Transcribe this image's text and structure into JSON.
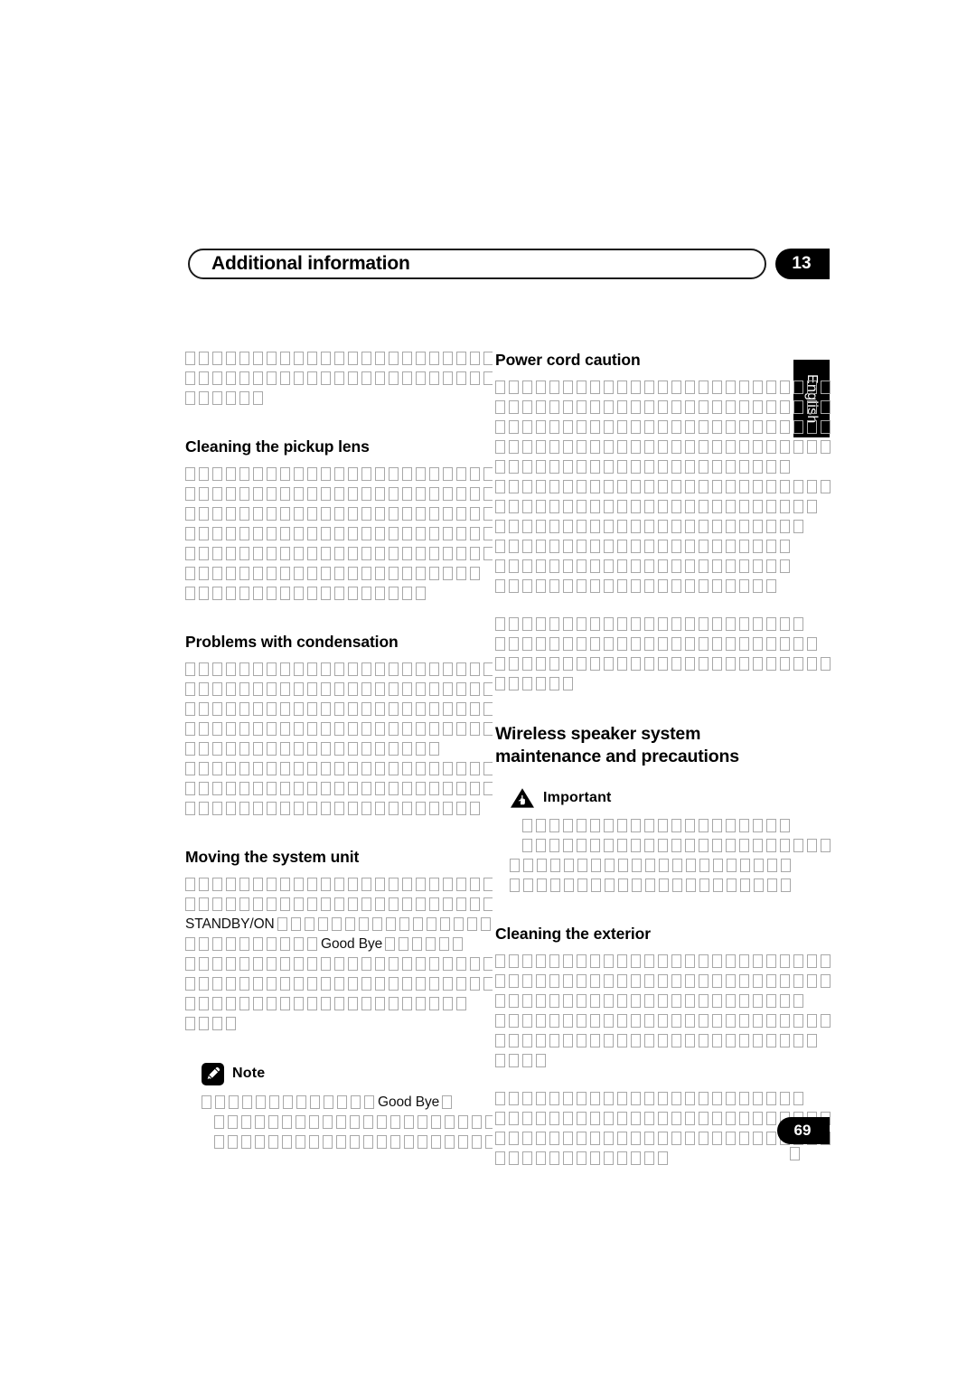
{
  "document": {
    "chapter_number": "13",
    "chapter_title": "Additional information",
    "page_number": "69",
    "language_tab": "English",
    "footer_mark": "□"
  },
  "icons": {
    "note": "pencil-icon",
    "important": "warning-triangle-hand-icon"
  },
  "left_column": {
    "intro_paragraph": {
      "lines": [
        {
          "boxes": 24
        },
        {
          "boxes": 24
        },
        {
          "boxes": 6
        }
      ]
    },
    "sections": [
      {
        "heading": "Cleaning the pickup lens",
        "paragraphs": [
          {
            "lines": [
              {
                "boxes": 24
              },
              {
                "boxes": 24
              },
              {
                "boxes": 24
              },
              {
                "boxes": 23
              },
              {
                "boxes": 23
              },
              {
                "boxes": 22
              },
              {
                "boxes": 18
              }
            ]
          }
        ]
      },
      {
        "heading": "Problems with condensation",
        "paragraphs": [
          {
            "lines": [
              {
                "boxes": 24
              },
              {
                "boxes": 24
              },
              {
                "boxes": 23
              },
              {
                "boxes": 23
              },
              {
                "boxes": 19
              },
              {
                "boxes": 23
              },
              {
                "boxes": 23
              },
              {
                "boxes": 22
              }
            ]
          }
        ]
      },
      {
        "heading": "Moving the system unit",
        "paragraphs": [
          {
            "lines": [
              {
                "boxes": 24
              },
              {
                "boxes": 24
              },
              {
                "runs": [
                  {
                    "type": "latin",
                    "text": "STANDBY/ON"
                  },
                  {
                    "type": "boxes",
                    "count": 17
                  }
                ]
              },
              {
                "runs": [
                  {
                    "type": "boxes",
                    "count": 10
                  },
                  {
                    "type": "latin",
                    "text": "Good Bye"
                  },
                  {
                    "type": "boxes",
                    "count": 6
                  }
                ]
              },
              {
                "boxes": 23
              },
              {
                "boxes": 23
              },
              {
                "boxes": 21
              },
              {
                "boxes": 4
              }
            ]
          }
        ]
      }
    ],
    "note_callout": {
      "label": "Note",
      "icon": "pencil-icon",
      "paragraphs": [
        {
          "lines": [
            {
              "runs": [
                {
                  "type": "boxes",
                  "count": 13
                },
                {
                  "type": "latin",
                  "text": "Good Bye"
                },
                {
                  "type": "boxes",
                  "count": 1
                }
              ]
            },
            {
              "boxes": 22,
              "indent": 14
            },
            {
              "boxes": 22,
              "indent": 14
            }
          ]
        }
      ]
    }
  },
  "right_column": {
    "sections": [
      {
        "heading": "Power cord caution",
        "paragraphs": [
          {
            "lines": [
              {
                "boxes": 26
              },
              {
                "boxes": 26
              },
              {
                "boxes": 26
              },
              {
                "boxes": 26
              },
              {
                "boxes": 22
              },
              {
                "boxes": 26
              },
              {
                "boxes": 24
              },
              {
                "boxes": 23
              },
              {
                "boxes": 22
              },
              {
                "boxes": 22
              },
              {
                "boxes": 21
              }
            ]
          },
          {
            "lines": [
              {
                "boxes": 23
              },
              {
                "boxes": 24
              },
              {
                "boxes": 26
              },
              {
                "boxes": 6
              }
            ]
          }
        ]
      },
      {
        "heading_major": "Wireless speaker system maintenance and precautions",
        "heading_major_lines": [
          "Wireless speaker system",
          "maintenance and precautions"
        ],
        "important_callout": {
          "label": "Important",
          "icon": "warning-triangle-hand-icon",
          "paragraphs": [
            {
              "lines": [
                {
                  "boxes": 20,
                  "indent": 14
                },
                {
                  "boxes": 23,
                  "indent": 14
                },
                {
                  "boxes": 21
                },
                {
                  "boxes": 21
                }
              ]
            }
          ]
        }
      },
      {
        "heading": "Cleaning the exterior",
        "paragraphs": [
          {
            "lines": [
              {
                "boxes": 25
              },
              {
                "boxes": 26
              },
              {
                "boxes": 23
              },
              {
                "boxes": 26
              },
              {
                "boxes": 24
              },
              {
                "boxes": 4
              }
            ]
          },
          {
            "lines": [
              {
                "boxes": 23
              },
              {
                "boxes": 25
              },
              {
                "boxes": 25
              },
              {
                "boxes": 13
              }
            ]
          }
        ]
      }
    ]
  }
}
